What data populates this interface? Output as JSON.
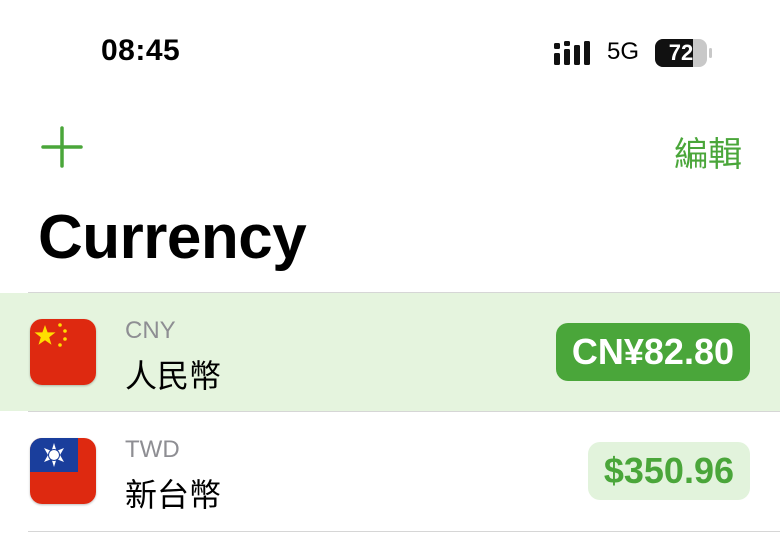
{
  "status_bar": {
    "time": "08:45",
    "network": "5G",
    "battery": "72"
  },
  "header": {
    "edit_label": "編輯",
    "title": "Currency"
  },
  "currencies": [
    {
      "code": "CNY",
      "name": "人民幣",
      "amount": "CN¥82.80",
      "selected": true,
      "flag": "china-flag-icon"
    },
    {
      "code": "TWD",
      "name": "新台幣",
      "amount": "$350.96",
      "selected": false,
      "flag": "taiwan-flag-icon"
    }
  ],
  "colors": {
    "accent": "#4aa63a",
    "selected_row": "#e5f4de",
    "amount_light": "#e2f3dc"
  }
}
